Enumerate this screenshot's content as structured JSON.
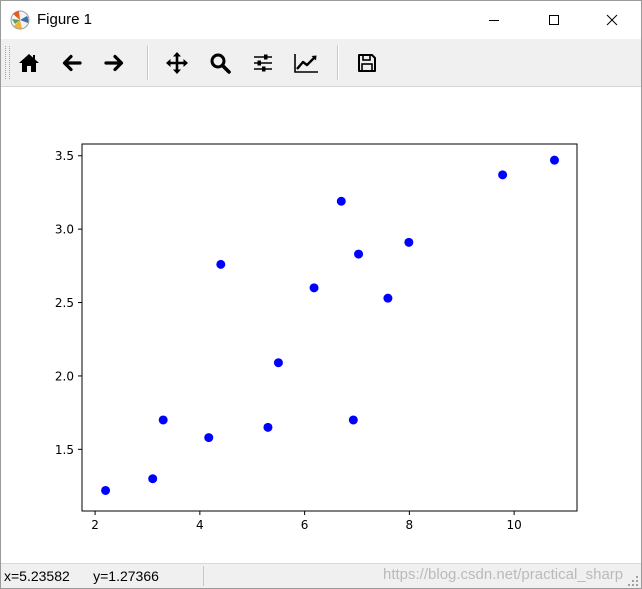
{
  "window": {
    "title": "Figure 1",
    "app_icon": "matplotlib-icon",
    "controls": [
      {
        "name": "minimize-button",
        "icon": "minimize-icon"
      },
      {
        "name": "maximize-button",
        "icon": "maximize-icon"
      },
      {
        "name": "close-button",
        "icon": "close-icon"
      }
    ]
  },
  "toolbar": {
    "buttons": [
      {
        "name": "home-button",
        "icon": "home-icon"
      },
      {
        "name": "back-button",
        "icon": "arrow-left-icon"
      },
      {
        "name": "forward-button",
        "icon": "arrow-right-icon"
      },
      {
        "name": "pan-button",
        "icon": "move-icon"
      },
      {
        "name": "zoom-button",
        "icon": "magnifier-icon"
      },
      {
        "name": "subplots-button",
        "icon": "sliders-icon"
      },
      {
        "name": "edit-axes-button",
        "icon": "line-chart-icon"
      },
      {
        "name": "save-button",
        "icon": "floppy-disk-icon"
      }
    ]
  },
  "chart_data": {
    "type": "scatter",
    "title": "",
    "xlabel": "",
    "ylabel": "",
    "xlim": [
      1.75,
      11.2
    ],
    "ylim": [
      1.08,
      3.58
    ],
    "xticks": [
      2,
      4,
      6,
      8,
      10
    ],
    "yticks": [
      1.5,
      2.0,
      2.5,
      3.0,
      3.5
    ],
    "xtick_labels": [
      "2",
      "4",
      "6",
      "8",
      "10"
    ],
    "ytick_labels": [
      "1.5",
      "2.0",
      "2.5",
      "3.0",
      "3.5"
    ],
    "grid": false,
    "color": "#0000ff",
    "points": [
      {
        "x": 2.2,
        "y": 1.22
      },
      {
        "x": 3.1,
        "y": 1.3
      },
      {
        "x": 3.3,
        "y": 1.7
      },
      {
        "x": 4.17,
        "y": 1.58
      },
      {
        "x": 4.4,
        "y": 2.76
      },
      {
        "x": 5.3,
        "y": 1.65
      },
      {
        "x": 5.5,
        "y": 2.09
      },
      {
        "x": 6.18,
        "y": 2.6
      },
      {
        "x": 6.7,
        "y": 3.19
      },
      {
        "x": 6.93,
        "y": 1.7
      },
      {
        "x": 7.03,
        "y": 2.83
      },
      {
        "x": 7.59,
        "y": 2.53
      },
      {
        "x": 7.99,
        "y": 2.91
      },
      {
        "x": 9.78,
        "y": 3.37
      },
      {
        "x": 10.77,
        "y": 3.47
      }
    ]
  },
  "status": {
    "coords": "x=5.23582      y=1.27366",
    "watermark": "https://blog.csdn.net/practical_sharp"
  }
}
